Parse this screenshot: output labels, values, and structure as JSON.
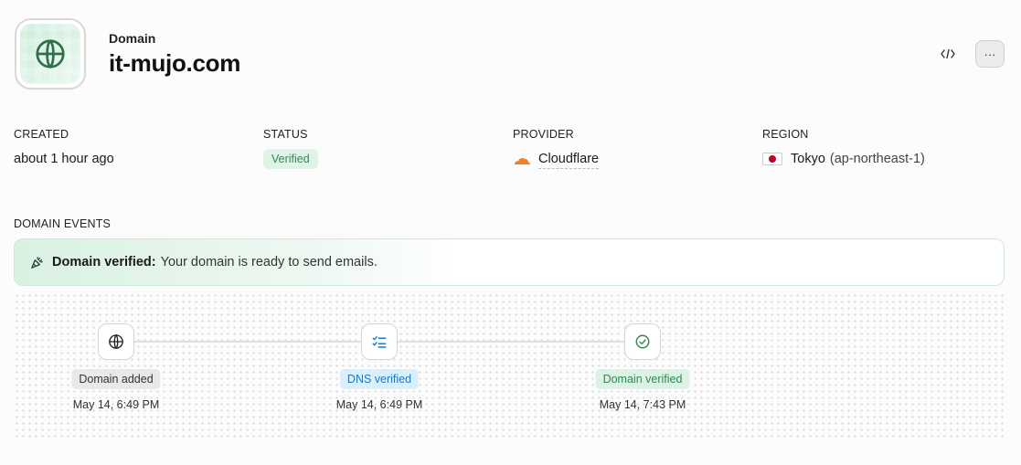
{
  "header": {
    "label": "Domain",
    "domain": "it-mujo.com"
  },
  "actions": {
    "code_icon": "code-icon",
    "more_label": "···"
  },
  "meta": {
    "created": {
      "label": "CREATED",
      "value": "about 1 hour ago"
    },
    "status": {
      "label": "STATUS",
      "value": "Verified"
    },
    "provider": {
      "label": "PROVIDER",
      "value": "Cloudflare",
      "color": "#f38020"
    },
    "region": {
      "label": "REGION",
      "value": "Tokyo",
      "code": "(ap-northeast-1)"
    }
  },
  "events": {
    "label": "DOMAIN EVENTS",
    "banner_strong": "Domain verified:",
    "banner_text": "Your domain is ready to send emails.",
    "steps": [
      {
        "label": "Domain added",
        "time": "May 14, 6:49 PM",
        "icon": "globe-icon"
      },
      {
        "label": "DNS verified",
        "time": "May 14, 6:49 PM",
        "icon": "checklist-icon"
      },
      {
        "label": "Domain verified",
        "time": "May 14, 7:43 PM",
        "icon": "check-circle-icon"
      }
    ]
  },
  "colors": {
    "accent_green": "#2e8a56",
    "accent_blue": "#1b79c6",
    "japan_red": "#bc002d"
  }
}
